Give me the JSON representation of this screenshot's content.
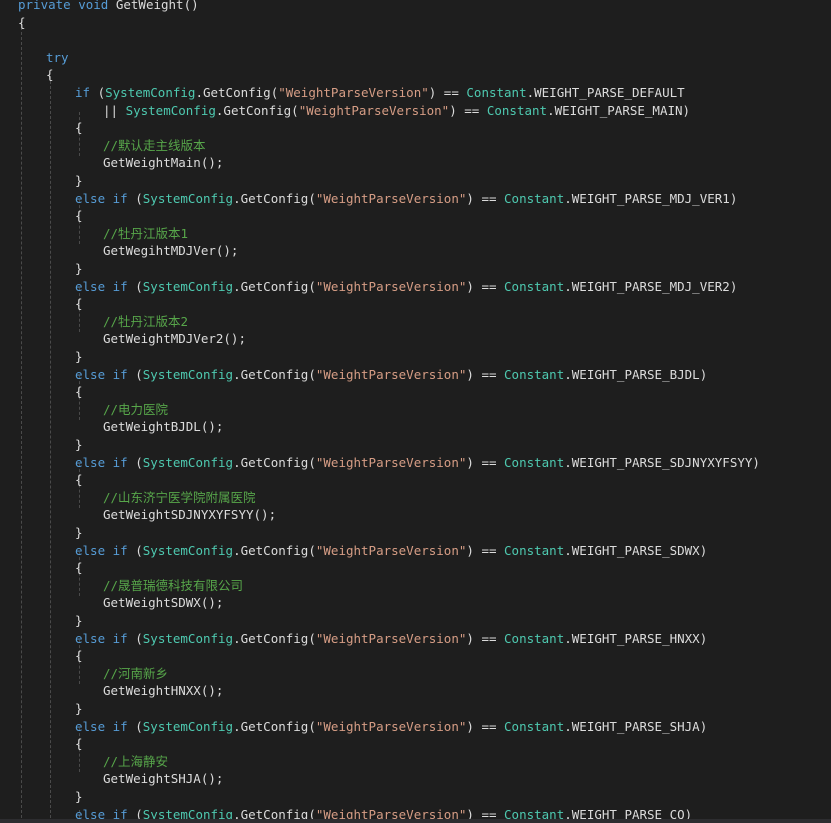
{
  "colors": {
    "background": "#1e1e1e",
    "keyword": "#569cd6",
    "type": "#4ec9b0",
    "string": "#d69d85",
    "comment": "#57a64a",
    "plain": "#dcdcdc"
  },
  "code": [
    {
      "indent": 18,
      "tokens": [
        {
          "t": "private",
          "c": "kw"
        },
        {
          "t": " "
        },
        {
          "t": "void",
          "c": "kw"
        },
        {
          "t": " GetWeight()"
        }
      ]
    },
    {
      "indent": 18,
      "tokens": [
        {
          "t": "{"
        }
      ]
    },
    {
      "indent": 18,
      "tokens": []
    },
    {
      "indent": 46,
      "tokens": [
        {
          "t": "try",
          "c": "kw"
        }
      ]
    },
    {
      "indent": 46,
      "tokens": [
        {
          "t": "{"
        }
      ]
    },
    {
      "indent": 75,
      "tokens": [
        {
          "t": "if",
          "c": "kw"
        },
        {
          "t": " ("
        },
        {
          "t": "SystemConfig",
          "c": "ty"
        },
        {
          "t": ".GetConfig("
        },
        {
          "t": "\"WeightParseVersion\"",
          "c": "str"
        },
        {
          "t": ") == "
        },
        {
          "t": "Constant",
          "c": "ty"
        },
        {
          "t": ".WEIGHT_PARSE_DEFAULT"
        }
      ]
    },
    {
      "indent": 103,
      "tokens": [
        {
          "t": "|| "
        },
        {
          "t": "SystemConfig",
          "c": "ty"
        },
        {
          "t": ".GetConfig("
        },
        {
          "t": "\"WeightParseVersion\"",
          "c": "str"
        },
        {
          "t": ") == "
        },
        {
          "t": "Constant",
          "c": "ty"
        },
        {
          "t": ".WEIGHT_PARSE_MAIN)"
        }
      ]
    },
    {
      "indent": 75,
      "tokens": [
        {
          "t": "{"
        }
      ]
    },
    {
      "indent": 103,
      "tokens": [
        {
          "t": "//默认走主线版本",
          "c": "cm"
        }
      ]
    },
    {
      "indent": 103,
      "tokens": [
        {
          "t": "GetWeightMain();"
        }
      ]
    },
    {
      "indent": 75,
      "tokens": [
        {
          "t": "}"
        }
      ]
    },
    {
      "indent": 75,
      "tokens": [
        {
          "t": "else",
          "c": "kw"
        },
        {
          "t": " "
        },
        {
          "t": "if",
          "c": "kw"
        },
        {
          "t": " ("
        },
        {
          "t": "SystemConfig",
          "c": "ty"
        },
        {
          "t": ".GetConfig("
        },
        {
          "t": "\"WeightParseVersion\"",
          "c": "str"
        },
        {
          "t": ") == "
        },
        {
          "t": "Constant",
          "c": "ty"
        },
        {
          "t": ".WEIGHT_PARSE_MDJ_VER1)"
        }
      ]
    },
    {
      "indent": 75,
      "tokens": [
        {
          "t": "{"
        }
      ]
    },
    {
      "indent": 103,
      "tokens": [
        {
          "t": "//牡丹江版本1",
          "c": "cm"
        }
      ]
    },
    {
      "indent": 103,
      "tokens": [
        {
          "t": "GetWegihtMDJVer();"
        }
      ]
    },
    {
      "indent": 75,
      "tokens": [
        {
          "t": "}"
        }
      ]
    },
    {
      "indent": 75,
      "tokens": [
        {
          "t": "else",
          "c": "kw"
        },
        {
          "t": " "
        },
        {
          "t": "if",
          "c": "kw"
        },
        {
          "t": " ("
        },
        {
          "t": "SystemConfig",
          "c": "ty"
        },
        {
          "t": ".GetConfig("
        },
        {
          "t": "\"WeightParseVersion\"",
          "c": "str"
        },
        {
          "t": ") == "
        },
        {
          "t": "Constant",
          "c": "ty"
        },
        {
          "t": ".WEIGHT_PARSE_MDJ_VER2)"
        }
      ]
    },
    {
      "indent": 75,
      "tokens": [
        {
          "t": "{"
        }
      ]
    },
    {
      "indent": 103,
      "tokens": [
        {
          "t": "//牡丹江版本2",
          "c": "cm"
        }
      ]
    },
    {
      "indent": 103,
      "tokens": [
        {
          "t": "GetWeightMDJVer2();"
        }
      ]
    },
    {
      "indent": 75,
      "tokens": [
        {
          "t": "}"
        }
      ]
    },
    {
      "indent": 75,
      "tokens": [
        {
          "t": "else",
          "c": "kw"
        },
        {
          "t": " "
        },
        {
          "t": "if",
          "c": "kw"
        },
        {
          "t": " ("
        },
        {
          "t": "SystemConfig",
          "c": "ty"
        },
        {
          "t": ".GetConfig("
        },
        {
          "t": "\"WeightParseVersion\"",
          "c": "str"
        },
        {
          "t": ") == "
        },
        {
          "t": "Constant",
          "c": "ty"
        },
        {
          "t": ".WEIGHT_PARSE_BJDL)"
        }
      ]
    },
    {
      "indent": 75,
      "tokens": [
        {
          "t": "{"
        }
      ]
    },
    {
      "indent": 103,
      "tokens": [
        {
          "t": "//电力医院",
          "c": "cm"
        }
      ]
    },
    {
      "indent": 103,
      "tokens": [
        {
          "t": "GetWeightBJDL();"
        }
      ]
    },
    {
      "indent": 75,
      "tokens": [
        {
          "t": "}"
        }
      ]
    },
    {
      "indent": 75,
      "tokens": [
        {
          "t": "else",
          "c": "kw"
        },
        {
          "t": " "
        },
        {
          "t": "if",
          "c": "kw"
        },
        {
          "t": " ("
        },
        {
          "t": "SystemConfig",
          "c": "ty"
        },
        {
          "t": ".GetConfig("
        },
        {
          "t": "\"WeightParseVersion\"",
          "c": "str"
        },
        {
          "t": ") == "
        },
        {
          "t": "Constant",
          "c": "ty"
        },
        {
          "t": ".WEIGHT_PARSE_SDJNYXYFSYY)"
        }
      ]
    },
    {
      "indent": 75,
      "tokens": [
        {
          "t": "{"
        }
      ]
    },
    {
      "indent": 103,
      "tokens": [
        {
          "t": "//山东济宁医学院附属医院",
          "c": "cm"
        }
      ]
    },
    {
      "indent": 103,
      "tokens": [
        {
          "t": "GetWeightSDJNYXYFSYY();"
        }
      ]
    },
    {
      "indent": 75,
      "tokens": [
        {
          "t": "}"
        }
      ]
    },
    {
      "indent": 75,
      "tokens": [
        {
          "t": "else",
          "c": "kw"
        },
        {
          "t": " "
        },
        {
          "t": "if",
          "c": "kw"
        },
        {
          "t": " ("
        },
        {
          "t": "SystemConfig",
          "c": "ty"
        },
        {
          "t": ".GetConfig("
        },
        {
          "t": "\"WeightParseVersion\"",
          "c": "str"
        },
        {
          "t": ") == "
        },
        {
          "t": "Constant",
          "c": "ty"
        },
        {
          "t": ".WEIGHT_PARSE_SDWX)"
        }
      ]
    },
    {
      "indent": 75,
      "tokens": [
        {
          "t": "{"
        }
      ]
    },
    {
      "indent": 103,
      "tokens": [
        {
          "t": "//晟普瑞德科技有限公司",
          "c": "cm"
        }
      ]
    },
    {
      "indent": 103,
      "tokens": [
        {
          "t": "GetWeightSDWX();"
        }
      ]
    },
    {
      "indent": 75,
      "tokens": [
        {
          "t": "}"
        }
      ]
    },
    {
      "indent": 75,
      "tokens": [
        {
          "t": "else",
          "c": "kw"
        },
        {
          "t": " "
        },
        {
          "t": "if",
          "c": "kw"
        },
        {
          "t": " ("
        },
        {
          "t": "SystemConfig",
          "c": "ty"
        },
        {
          "t": ".GetConfig("
        },
        {
          "t": "\"WeightParseVersion\"",
          "c": "str"
        },
        {
          "t": ") == "
        },
        {
          "t": "Constant",
          "c": "ty"
        },
        {
          "t": ".WEIGHT_PARSE_HNXX)"
        }
      ]
    },
    {
      "indent": 75,
      "tokens": [
        {
          "t": "{"
        }
      ]
    },
    {
      "indent": 103,
      "tokens": [
        {
          "t": "//河南新乡",
          "c": "cm"
        }
      ]
    },
    {
      "indent": 103,
      "tokens": [
        {
          "t": "GetWeightHNXX();"
        }
      ]
    },
    {
      "indent": 75,
      "tokens": [
        {
          "t": "}"
        }
      ]
    },
    {
      "indent": 75,
      "tokens": [
        {
          "t": "else",
          "c": "kw"
        },
        {
          "t": " "
        },
        {
          "t": "if",
          "c": "kw"
        },
        {
          "t": " ("
        },
        {
          "t": "SystemConfig",
          "c": "ty"
        },
        {
          "t": ".GetConfig("
        },
        {
          "t": "\"WeightParseVersion\"",
          "c": "str"
        },
        {
          "t": ") == "
        },
        {
          "t": "Constant",
          "c": "ty"
        },
        {
          "t": ".WEIGHT_PARSE_SHJA)"
        }
      ]
    },
    {
      "indent": 75,
      "tokens": [
        {
          "t": "{"
        }
      ]
    },
    {
      "indent": 103,
      "tokens": [
        {
          "t": "//上海静安",
          "c": "cm"
        }
      ]
    },
    {
      "indent": 103,
      "tokens": [
        {
          "t": "GetWeightSHJA();"
        }
      ]
    },
    {
      "indent": 75,
      "tokens": [
        {
          "t": "}"
        }
      ]
    },
    {
      "indent": 75,
      "tokens": [
        {
          "t": "else",
          "c": "kw"
        },
        {
          "t": " "
        },
        {
          "t": "if",
          "c": "kw"
        },
        {
          "t": " ("
        },
        {
          "t": "SystemConfig",
          "c": "ty"
        },
        {
          "t": ".GetConfig("
        },
        {
          "t": "\"WeightParseVersion\"",
          "c": "str"
        },
        {
          "t": ") == "
        },
        {
          "t": "Constant",
          "c": "ty"
        },
        {
          "t": ".WEIGHT_PARSE_CQ)"
        }
      ]
    },
    {
      "indent": 75,
      "tokens": [
        {
          "t": "{"
        }
      ]
    }
  ]
}
